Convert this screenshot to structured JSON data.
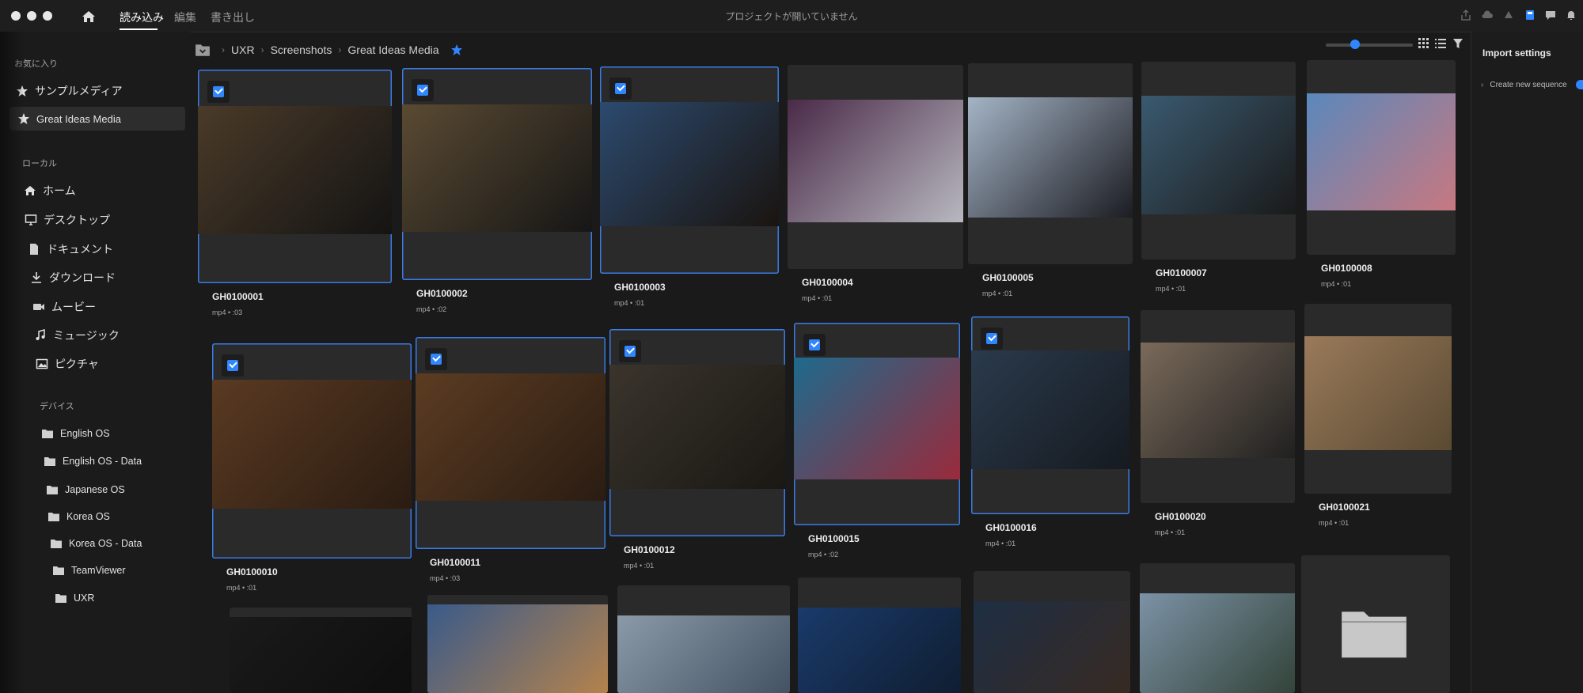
{
  "window": {
    "title": "プロジェクトが開いていません",
    "tabs": [
      "読み込み",
      "編集",
      "書き出し"
    ],
    "active_tab": "読み込み"
  },
  "sidebar": {
    "favorites_heading": "お気に入り",
    "favorites": [
      {
        "label": "サンプルメディア",
        "icon": "star-icon"
      },
      {
        "label": "Great Ideas Media",
        "icon": "star-icon",
        "selected": true
      }
    ],
    "local_heading": "ローカル",
    "local": [
      {
        "label": "ホーム",
        "icon": "home-icon"
      },
      {
        "label": "デスクトップ",
        "icon": "monitor-icon"
      },
      {
        "label": "ドキュメント",
        "icon": "document-icon"
      },
      {
        "label": "ダウンロード",
        "icon": "download-icon"
      },
      {
        "label": "ムービー",
        "icon": "video-icon"
      },
      {
        "label": "ミュージック",
        "icon": "music-icon"
      },
      {
        "label": "ピクチャ",
        "icon": "image-icon"
      }
    ],
    "devices_heading": "デバイス",
    "devices": [
      {
        "label": "English OS",
        "icon": "folder-icon"
      },
      {
        "label": "English OS - Data",
        "icon": "folder-icon"
      },
      {
        "label": "Japanese OS",
        "icon": "folder-icon"
      },
      {
        "label": "Korea OS",
        "icon": "folder-icon"
      },
      {
        "label": "Korea OS - Data",
        "icon": "folder-icon"
      },
      {
        "label": "TeamViewer",
        "icon": "folder-icon"
      },
      {
        "label": "UXR",
        "icon": "folder-icon"
      }
    ]
  },
  "breadcrumb": [
    "UXR",
    "Screenshots",
    "Great Ideas Media"
  ],
  "right_panel": {
    "title": "Import settings",
    "create_sequence_label": "Create new sequence",
    "create_sequence_on": true
  },
  "media": [
    {
      "name": "GH0100001",
      "meta": "mp4 • :03",
      "selected": true,
      "tone": [
        "#4a3a28",
        "#141414"
      ]
    },
    {
      "name": "GH0100002",
      "meta": "mp4 • :02",
      "selected": true,
      "tone": [
        "#5a4a32",
        "#161616"
      ]
    },
    {
      "name": "GH0100003",
      "meta": "mp4 • :01",
      "selected": true,
      "tone": [
        "#2c4a6e",
        "#1a1410"
      ]
    },
    {
      "name": "GH0100004",
      "meta": "mp4 • :01",
      "selected": false,
      "tone": [
        "#4a2a48",
        "#b8b8c0"
      ]
    },
    {
      "name": "GH0100005",
      "meta": "mp4 • :01",
      "selected": false,
      "tone": [
        "#a4b4c6",
        "#1c1c22"
      ]
    },
    {
      "name": "GH0100007",
      "meta": "mp4 • :01",
      "selected": false,
      "tone": [
        "#3a5a70",
        "#1a1a1a"
      ]
    },
    {
      "name": "GH0100008",
      "meta": "mp4 • :01",
      "selected": false,
      "tone": [
        "#5a88bc",
        "#c87880"
      ]
    },
    {
      "name": "GH0100010",
      "meta": "mp4 • :01",
      "selected": true,
      "tone": [
        "#5a3a22",
        "#2a1c12"
      ]
    },
    {
      "name": "GH0100011",
      "meta": "mp4 • :03",
      "selected": true,
      "tone": [
        "#5c3c22",
        "#2a1c12"
      ]
    },
    {
      "name": "GH0100012",
      "meta": "mp4 • :01",
      "selected": true,
      "tone": [
        "#3a342c",
        "#1a1814"
      ]
    },
    {
      "name": "GH0100015",
      "meta": "mp4 • :02",
      "selected": true,
      "tone": [
        "#1e6a8c",
        "#9a2a3c"
      ]
    },
    {
      "name": "GH0100016",
      "meta": "mp4 • :01",
      "selected": true,
      "tone": [
        "#2a3a4c",
        "#161a20"
      ]
    },
    {
      "name": "GH0100020",
      "meta": "mp4 • :01",
      "selected": false,
      "tone": [
        "#7a6a5a",
        "#202020"
      ]
    },
    {
      "name": "GH0100021",
      "meta": "mp4 • :01",
      "selected": false,
      "tone": [
        "#9a7a5a",
        "#5a4a32"
      ]
    },
    {
      "name": "",
      "meta": "",
      "selected": false,
      "tone": [
        "#1a1a1a",
        "#0e0e0e"
      ]
    },
    {
      "name": "",
      "meta": "",
      "selected": false,
      "tone": [
        "#3a5a8a",
        "#b8844a"
      ]
    },
    {
      "name": "",
      "meta": "",
      "selected": false,
      "tone": [
        "#8a9aa8",
        "#3a4a5a"
      ]
    },
    {
      "name": "",
      "meta": "",
      "selected": false,
      "tone": [
        "#1a3a6a",
        "#0e1a2a"
      ]
    },
    {
      "name": "",
      "meta": "",
      "selected": false,
      "tone": [
        "#1e2e44",
        "#3a2a1e"
      ]
    },
    {
      "name": "",
      "meta": "",
      "selected": false,
      "tone": [
        "#7c92a6",
        "#2a3a2c"
      ]
    },
    {
      "name": "",
      "meta": "",
      "selected": false,
      "tone": [
        "#2a2a2a",
        "#2a2a2a"
      ],
      "folder": true
    }
  ],
  "colors": {
    "accent": "#2f86ff",
    "selection_border": "#3a7be6"
  }
}
